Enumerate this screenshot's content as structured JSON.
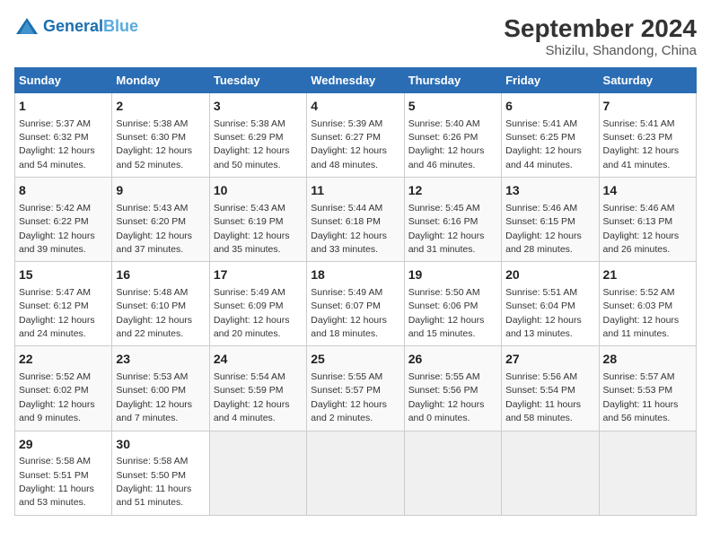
{
  "header": {
    "logo_general": "General",
    "logo_blue": "Blue",
    "title": "September 2024",
    "subtitle": "Shizilu, Shandong, China"
  },
  "weekdays": [
    "Sunday",
    "Monday",
    "Tuesday",
    "Wednesday",
    "Thursday",
    "Friday",
    "Saturday"
  ],
  "weeks": [
    [
      {
        "day": 1,
        "sunrise": "5:37 AM",
        "sunset": "6:32 PM",
        "daylight": "12 hours and 54 minutes."
      },
      {
        "day": 2,
        "sunrise": "5:38 AM",
        "sunset": "6:30 PM",
        "daylight": "12 hours and 52 minutes."
      },
      {
        "day": 3,
        "sunrise": "5:38 AM",
        "sunset": "6:29 PM",
        "daylight": "12 hours and 50 minutes."
      },
      {
        "day": 4,
        "sunrise": "5:39 AM",
        "sunset": "6:27 PM",
        "daylight": "12 hours and 48 minutes."
      },
      {
        "day": 5,
        "sunrise": "5:40 AM",
        "sunset": "6:26 PM",
        "daylight": "12 hours and 46 minutes."
      },
      {
        "day": 6,
        "sunrise": "5:41 AM",
        "sunset": "6:25 PM",
        "daylight": "12 hours and 44 minutes."
      },
      {
        "day": 7,
        "sunrise": "5:41 AM",
        "sunset": "6:23 PM",
        "daylight": "12 hours and 41 minutes."
      }
    ],
    [
      {
        "day": 8,
        "sunrise": "5:42 AM",
        "sunset": "6:22 PM",
        "daylight": "12 hours and 39 minutes."
      },
      {
        "day": 9,
        "sunrise": "5:43 AM",
        "sunset": "6:20 PM",
        "daylight": "12 hours and 37 minutes."
      },
      {
        "day": 10,
        "sunrise": "5:43 AM",
        "sunset": "6:19 PM",
        "daylight": "12 hours and 35 minutes."
      },
      {
        "day": 11,
        "sunrise": "5:44 AM",
        "sunset": "6:18 PM",
        "daylight": "12 hours and 33 minutes."
      },
      {
        "day": 12,
        "sunrise": "5:45 AM",
        "sunset": "6:16 PM",
        "daylight": "12 hours and 31 minutes."
      },
      {
        "day": 13,
        "sunrise": "5:46 AM",
        "sunset": "6:15 PM",
        "daylight": "12 hours and 28 minutes."
      },
      {
        "day": 14,
        "sunrise": "5:46 AM",
        "sunset": "6:13 PM",
        "daylight": "12 hours and 26 minutes."
      }
    ],
    [
      {
        "day": 15,
        "sunrise": "5:47 AM",
        "sunset": "6:12 PM",
        "daylight": "12 hours and 24 minutes."
      },
      {
        "day": 16,
        "sunrise": "5:48 AM",
        "sunset": "6:10 PM",
        "daylight": "12 hours and 22 minutes."
      },
      {
        "day": 17,
        "sunrise": "5:49 AM",
        "sunset": "6:09 PM",
        "daylight": "12 hours and 20 minutes."
      },
      {
        "day": 18,
        "sunrise": "5:49 AM",
        "sunset": "6:07 PM",
        "daylight": "12 hours and 18 minutes."
      },
      {
        "day": 19,
        "sunrise": "5:50 AM",
        "sunset": "6:06 PM",
        "daylight": "12 hours and 15 minutes."
      },
      {
        "day": 20,
        "sunrise": "5:51 AM",
        "sunset": "6:04 PM",
        "daylight": "12 hours and 13 minutes."
      },
      {
        "day": 21,
        "sunrise": "5:52 AM",
        "sunset": "6:03 PM",
        "daylight": "12 hours and 11 minutes."
      }
    ],
    [
      {
        "day": 22,
        "sunrise": "5:52 AM",
        "sunset": "6:02 PM",
        "daylight": "12 hours and 9 minutes."
      },
      {
        "day": 23,
        "sunrise": "5:53 AM",
        "sunset": "6:00 PM",
        "daylight": "12 hours and 7 minutes."
      },
      {
        "day": 24,
        "sunrise": "5:54 AM",
        "sunset": "5:59 PM",
        "daylight": "12 hours and 4 minutes."
      },
      {
        "day": 25,
        "sunrise": "5:55 AM",
        "sunset": "5:57 PM",
        "daylight": "12 hours and 2 minutes."
      },
      {
        "day": 26,
        "sunrise": "5:55 AM",
        "sunset": "5:56 PM",
        "daylight": "12 hours and 0 minutes."
      },
      {
        "day": 27,
        "sunrise": "5:56 AM",
        "sunset": "5:54 PM",
        "daylight": "11 hours and 58 minutes."
      },
      {
        "day": 28,
        "sunrise": "5:57 AM",
        "sunset": "5:53 PM",
        "daylight": "11 hours and 56 minutes."
      }
    ],
    [
      {
        "day": 29,
        "sunrise": "5:58 AM",
        "sunset": "5:51 PM",
        "daylight": "11 hours and 53 minutes."
      },
      {
        "day": 30,
        "sunrise": "5:58 AM",
        "sunset": "5:50 PM",
        "daylight": "11 hours and 51 minutes."
      },
      null,
      null,
      null,
      null,
      null
    ]
  ]
}
